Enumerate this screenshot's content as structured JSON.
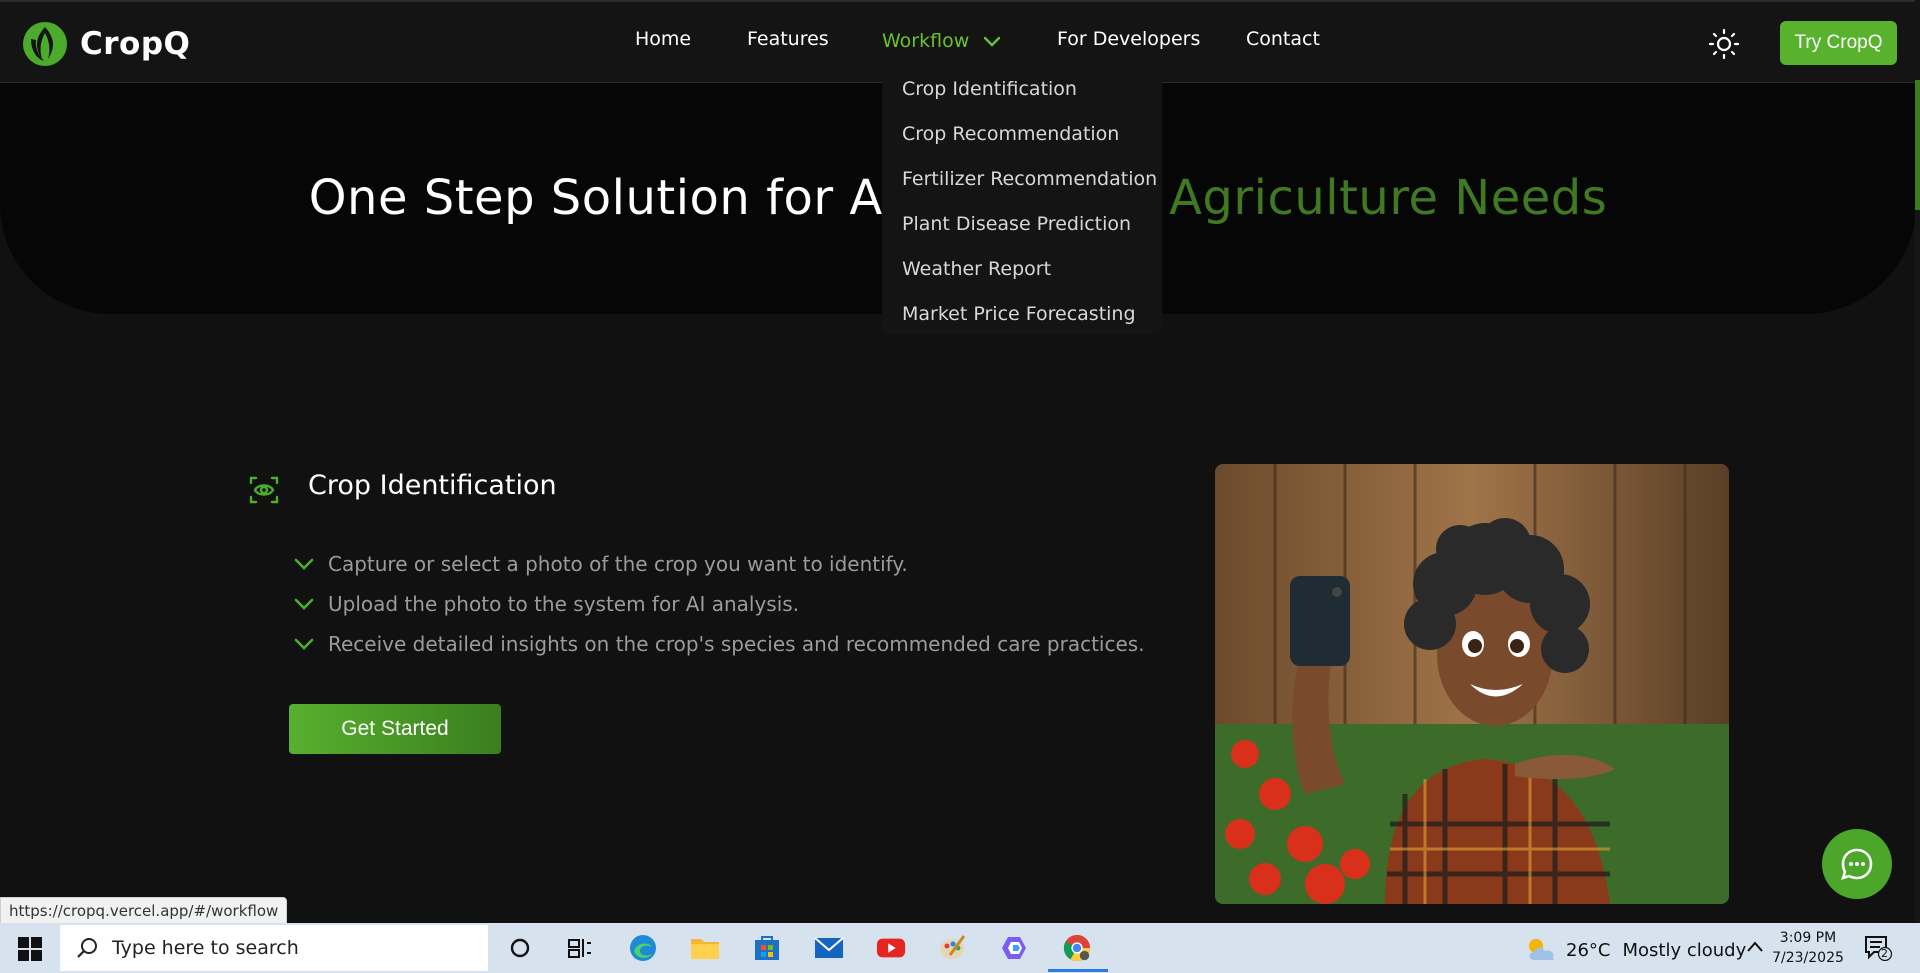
{
  "brand": {
    "name": "CropQ"
  },
  "nav": {
    "items": [
      {
        "label": "Home"
      },
      {
        "label": "Features"
      },
      {
        "label": "Workflow"
      },
      {
        "label": "For Developers"
      },
      {
        "label": "Contact"
      }
    ],
    "active": "Workflow",
    "try_label": "Try CropQ"
  },
  "dropdown": {
    "items": [
      "Crop Identification",
      "Crop Recommendation",
      "Fertilizer Recommendation",
      "Plant Disease Prediction",
      "Weather Report",
      "Market Price Forecasting"
    ]
  },
  "hero": {
    "title_part1": "One Step Solution for All AI-Dri",
    "title_part2": "ven Agriculture Needs"
  },
  "section": {
    "title": "Crop Identification",
    "bullets": [
      "Capture or select a photo of the crop you want to identify.",
      "Upload the photo to the system for AI analysis.",
      "Receive detailed insights on the crop's species and recommended care practices."
    ],
    "cta": "Get Started"
  },
  "status_url": "https://cropq.vercel.app/#/workflow",
  "taskbar": {
    "search_placeholder": "Type here to search",
    "weather_temp": "26°C",
    "weather_condition": "Mostly cloudy",
    "time": "3:09 PM",
    "date": "7/23/2025",
    "notification_count": "2"
  },
  "colors": {
    "accent": "#58b22e",
    "background": "#111111",
    "hero_bg": "#060606"
  }
}
